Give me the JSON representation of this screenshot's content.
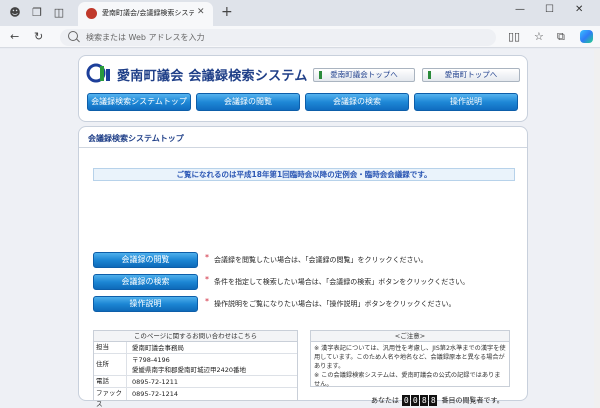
{
  "browser": {
    "tab_title": "愛南町議会/会議録検索システム",
    "address_placeholder": "検索または Web アドレスを入力"
  },
  "header": {
    "site_title": "愛南町議会 会議録検索システム",
    "link_council": "愛南町議会トップへ",
    "link_town": "愛南町トップへ",
    "nav": [
      "会議録検索システムトップ",
      "会議録の閲覧",
      "会議録の検索",
      "操作説明"
    ]
  },
  "main": {
    "section_title": "会議録検索システムトップ",
    "notice": "ご覧になれるのは平成18年第1回臨時会以降の定例会・臨時会会議録です。",
    "actions": [
      {
        "label": "会議録の閲覧",
        "star": "*",
        "desc": "会議録を閲覧したい場合は、「会議録の閲覧」をクリックください。"
      },
      {
        "label": "会議録の検索",
        "star": "*",
        "desc": "条件を指定して検索したい場合は、「会議録の検索」ボタンをクリックください。"
      },
      {
        "label": "操作説明",
        "star": "*",
        "desc": "操作説明をご覧になりたい場合は、「操作説明」ボタンをクリックください。"
      }
    ]
  },
  "contact": {
    "heading": "このページに関するお問い合わせはこちら",
    "rows": [
      {
        "label": "担当",
        "value": "愛南町議会事務局"
      },
      {
        "label": "住所",
        "value": "〒798-4196",
        "value2": "愛媛県南宇和郡愛南町城辺甲2420番地"
      },
      {
        "label": "電話",
        "value": "0895-72-1211"
      },
      {
        "label": "ファックス",
        "value": "0895-72-1214"
      }
    ]
  },
  "caution": {
    "heading": "<ご注意>",
    "line1": "※ 漢字表記については、汎用性を考慮し、JIS第2水準までの漢字を使用しています。このため人名や地名など、会議録原本と異なる場合があります。",
    "line2": "※ この会議録検索システムは、愛南町議会の公式の記録ではありません。"
  },
  "counter": {
    "prefix": "あなたは",
    "digits": [
      "0",
      "0",
      "8",
      "8"
    ],
    "suffix": "番目の閲覧者です。"
  },
  "colors": {
    "brand_blue": "#1f3f88",
    "button_blue": "#1c86d4",
    "notice_text": "#2a56b4",
    "star_red": "#d0283b"
  }
}
